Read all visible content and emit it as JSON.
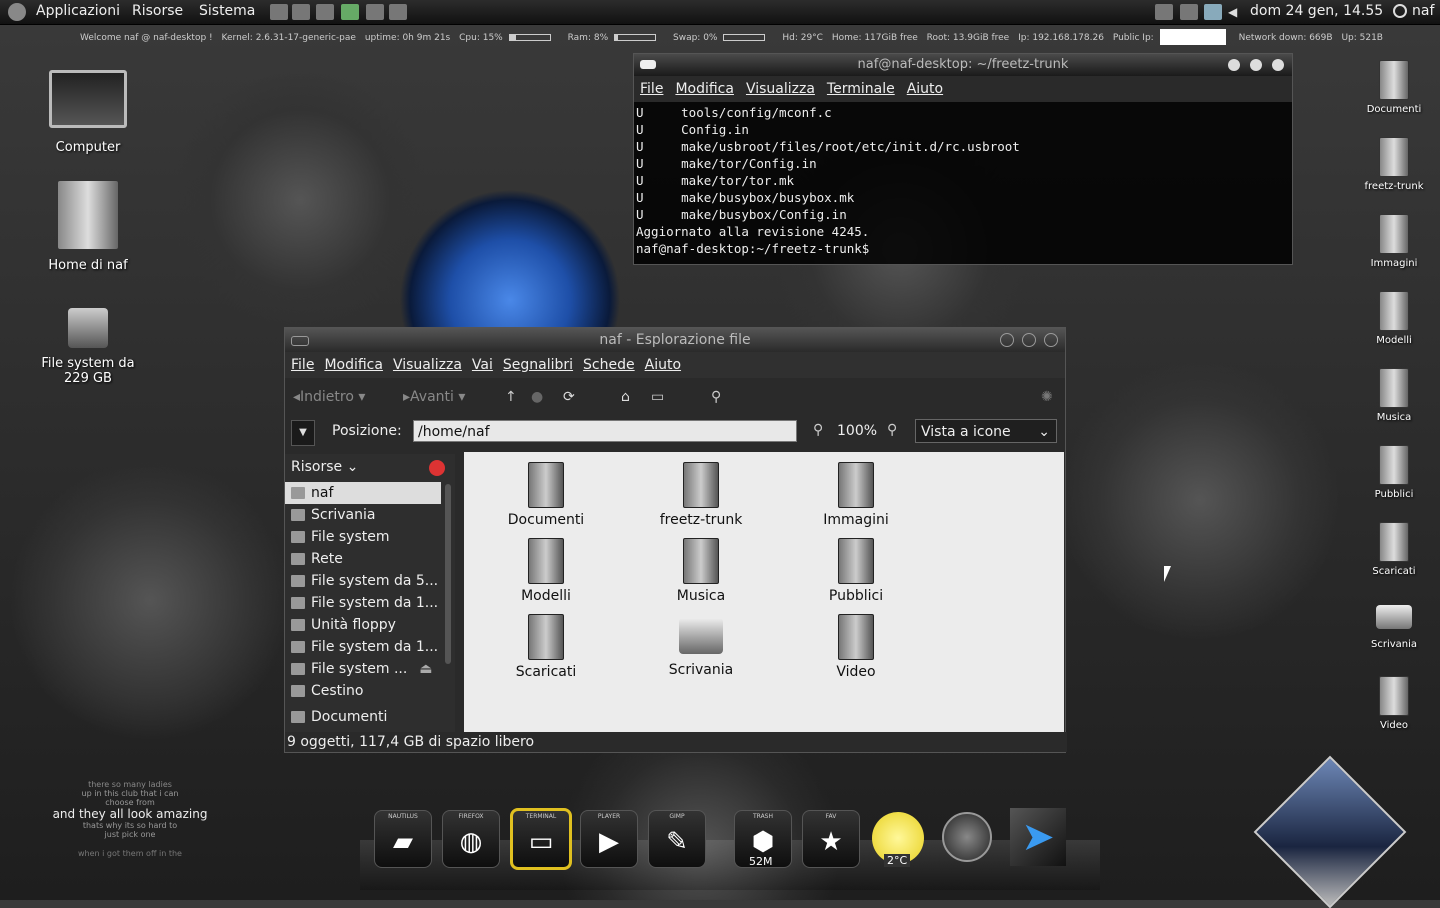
{
  "top_panel": {
    "menus": [
      "Applicazioni",
      "Risorse",
      "Sistema"
    ],
    "clock": "dom 24 gen, 14.55",
    "user": "naf"
  },
  "conky": {
    "welcome": "Welcome naf @ naf-desktop !",
    "kernel": "Kernel: 2.6.31-17-generic-pae",
    "uptime": "uptime: 0h 9m 21s",
    "cpu": "Cpu: 15%",
    "cpu_level": 0.15,
    "ram": "Ram: 8%",
    "ram_level": 0.08,
    "swap": "Swap: 0%",
    "swap_level": 0,
    "hd": "Hd: 29°C",
    "home": "Home: 117GiB free",
    "root": "Root: 13.9GiB free",
    "ip": "Ip: 192.168.178.26",
    "public_ip": "Public Ip:",
    "net_down": "Network down: 669B",
    "net_up": "Up: 521B"
  },
  "desktop_left": [
    {
      "label": "Computer",
      "icon": "monitor-icon"
    },
    {
      "label": "Home di naf",
      "icon": "home-icon"
    },
    {
      "label": "File system da 229 GB",
      "icon": "drive-icon"
    }
  ],
  "desktop_right": [
    "Documenti",
    "freetz-trunk",
    "Immagini",
    "Modelli",
    "Musica",
    "Pubblici",
    "Scaricati",
    "Scrivania",
    "Video"
  ],
  "terminal": {
    "title": "naf@naf-desktop: ~/freetz-trunk",
    "menu": [
      "File",
      "Modifica",
      "Visualizza",
      "Terminale",
      "Aiuto"
    ],
    "lines": [
      "U     tools/config/mconf.c",
      "U     Config.in",
      "U     make/usbroot/files/root/etc/init.d/rc.usbroot",
      "U     make/tor/Config.in",
      "U     make/tor/tor.mk",
      "U     make/busybox/busybox.mk",
      "U     make/busybox/Config.in",
      "Aggiornato alla revisione 4245.",
      "naf@naf-desktop:~/freetz-trunk$"
    ]
  },
  "filemanager": {
    "title": "naf - Esplorazione file",
    "menu": [
      "File",
      "Modifica",
      "Visualizza",
      "Vai",
      "Segnalibri",
      "Schede",
      "Aiuto"
    ],
    "back": "Indietro",
    "forward": "Avanti",
    "location_label": "Posizione:",
    "location": "/home/naf",
    "zoom": "100%",
    "view_mode": "Vista a icone",
    "sidebar_header": "Risorse",
    "sidebar": [
      "naf",
      "Scrivania",
      "File system",
      "Rete",
      "File system da 5...",
      "File system da 1...",
      "Unità floppy",
      "File system da 1...",
      "File system ...",
      "Cestino",
      "Documenti"
    ],
    "items": [
      "Documenti",
      "freetz-trunk",
      "Immagini",
      "Modelli",
      "Musica",
      "Pubblici",
      "Scaricati",
      "Scrivania",
      "Video"
    ],
    "status": "9 oggetti, 117,4 GB di spazio libero"
  },
  "dock": {
    "items": [
      {
        "label": "NAUTILUS",
        "icon": "folder-icon"
      },
      {
        "label": "FIREFOX",
        "icon": "globe-icon"
      },
      {
        "label": "TERMINAL",
        "icon": "terminal-icon"
      },
      {
        "label": "PLAYER",
        "icon": "play-icon"
      },
      {
        "label": "GIMP",
        "icon": "gimp-icon"
      },
      {
        "label": "TRASH",
        "icon": "trash-icon"
      },
      {
        "label": "FAV",
        "icon": "star-icon"
      }
    ],
    "trash_size": "52M",
    "weather_temp": "2°C"
  },
  "lyrics": {
    "lines": [
      "there so many ladies",
      "up in this club that i can",
      "choose from",
      "and they all look amazing",
      "thats why its so hard to",
      "just pick one",
      "when i got them off in the"
    ]
  }
}
